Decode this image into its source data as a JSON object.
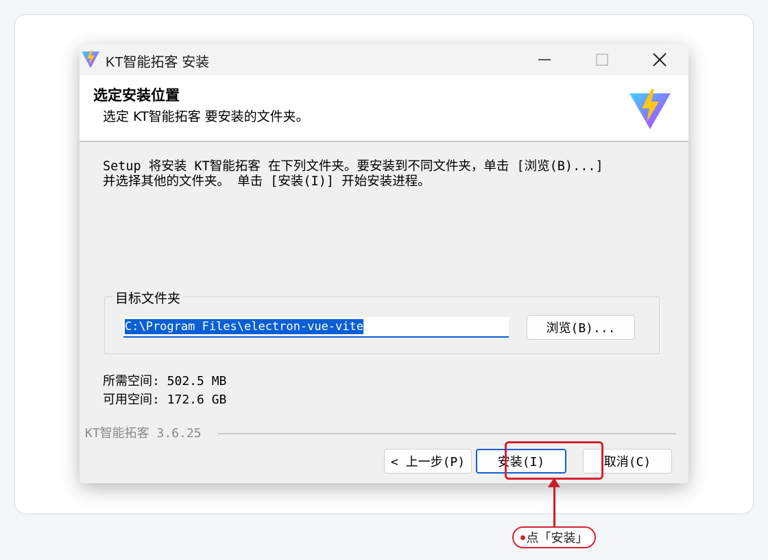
{
  "window": {
    "title": "KT智能拓客 安装"
  },
  "header": {
    "title": "选定安装位置",
    "subtitle": "选定 KT智能拓客 要安装的文件夹。"
  },
  "body": {
    "description_line1": "Setup 将安装 KT智能拓客 在下列文件夹。要安装到不同文件夹，单击 [浏览(B)...]",
    "description_line2": "并选择其他的文件夹。 单击 [安装(I)] 开始安装进程。",
    "group_label": "目标文件夹",
    "path_value": "C:\\Program Files\\electron-vue-vite",
    "browse_label": "浏览(B)...",
    "space_required": "所需空间: 502.5 MB",
    "space_available": "可用空间: 172.6 GB"
  },
  "footer": {
    "version": "KT智能拓客 3.6.25",
    "back_label": "< 上一步(P)",
    "install_label": "安装(I)",
    "cancel_label": "取消(C)"
  },
  "annotation": {
    "callout": "点「安装」"
  },
  "colors": {
    "accent": "#0a5fd4",
    "highlight": "#d6202f",
    "logo_purple": "#8f3dfb",
    "logo_yellow": "#ffc517"
  },
  "icons": [
    "vite-logo-icon",
    "minimize-icon",
    "maximize-icon",
    "close-icon"
  ]
}
